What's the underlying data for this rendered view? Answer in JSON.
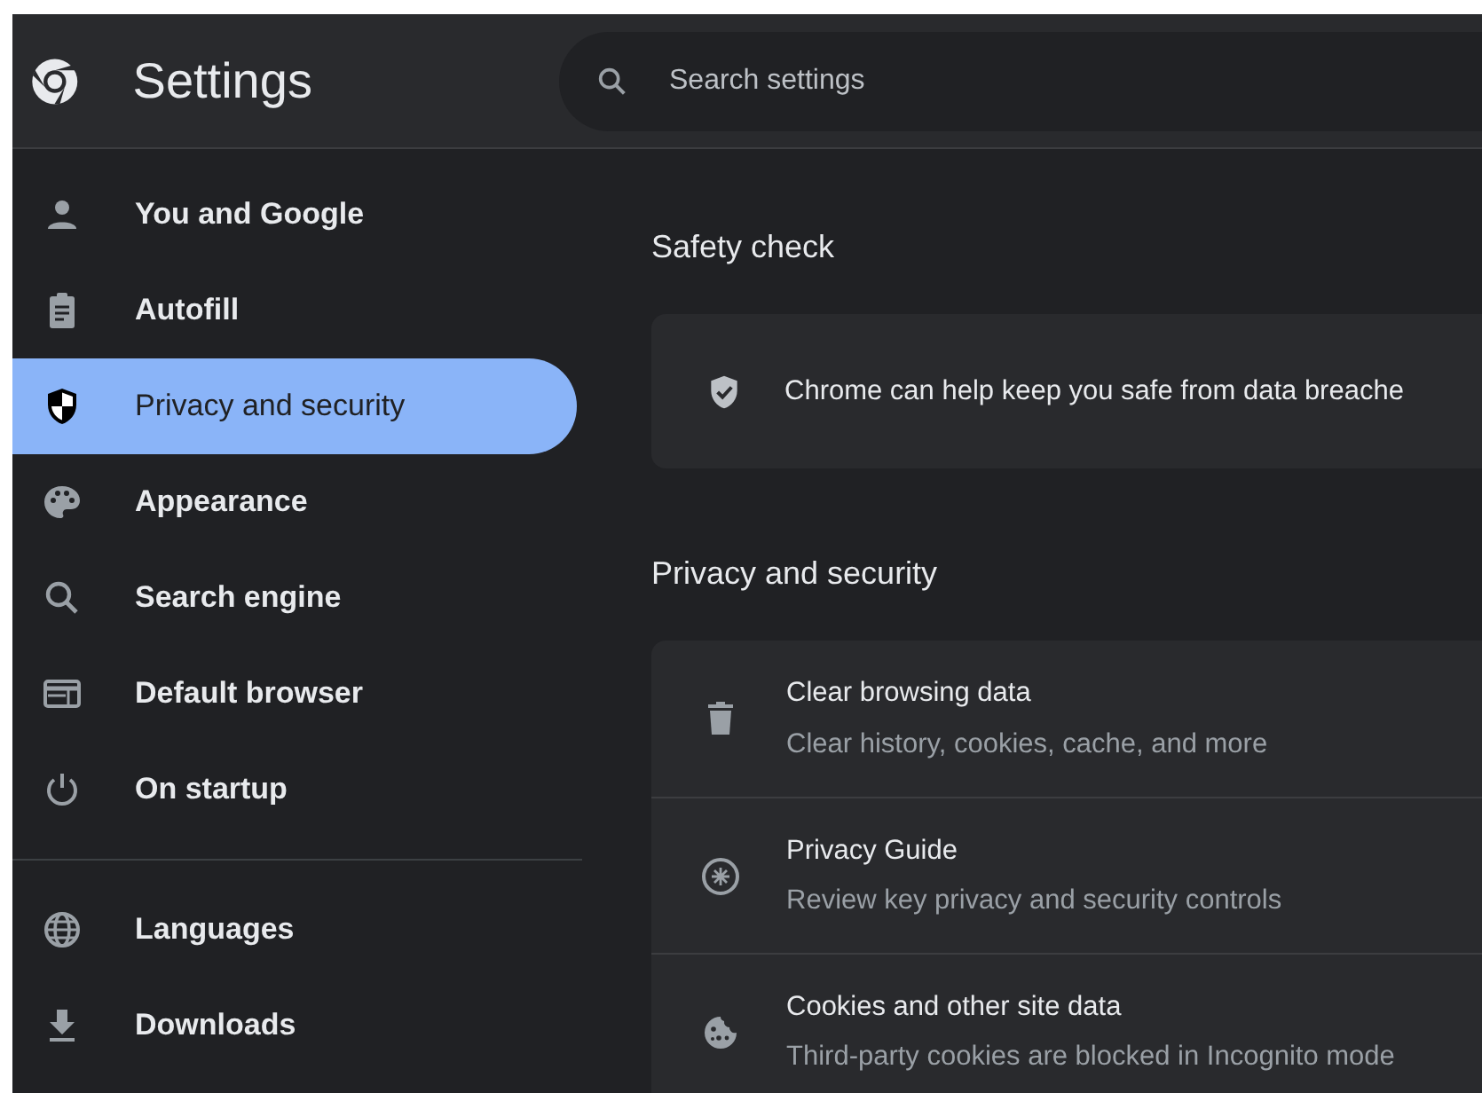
{
  "header": {
    "title": "Settings",
    "search": {
      "placeholder": "Search settings"
    }
  },
  "sidebar": {
    "items": [
      {
        "label": "You and Google",
        "selected": false
      },
      {
        "label": "Autofill",
        "selected": false
      },
      {
        "label": "Privacy and security",
        "selected": true
      },
      {
        "label": "Appearance",
        "selected": false
      },
      {
        "label": "Search engine",
        "selected": false
      },
      {
        "label": "Default browser",
        "selected": false
      },
      {
        "label": "On startup",
        "selected": false
      },
      {
        "label": "Languages",
        "selected": false
      },
      {
        "label": "Downloads",
        "selected": false
      }
    ]
  },
  "safety_check": {
    "heading": "Safety check",
    "text": "Chrome can help keep you safe from data breache"
  },
  "privacy": {
    "heading": "Privacy and security",
    "rows": [
      {
        "title": "Clear browsing data",
        "subtitle": "Clear history, cookies, cache, and more"
      },
      {
        "title": "Privacy Guide",
        "subtitle": "Review key privacy and security controls"
      },
      {
        "title": "Cookies and other site data",
        "subtitle": "Third-party cookies are blocked in Incognito mode"
      }
    ]
  }
}
